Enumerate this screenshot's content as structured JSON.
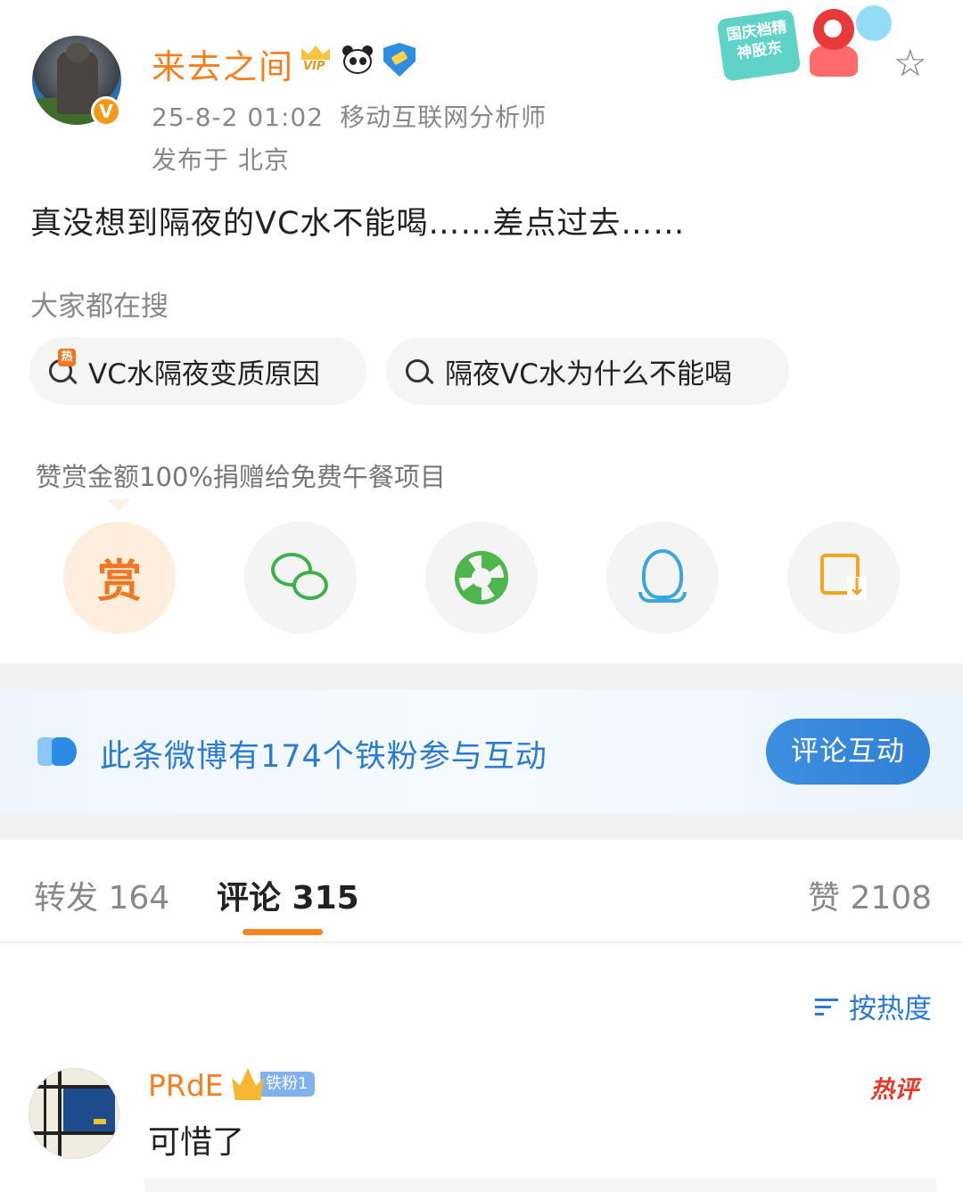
{
  "post": {
    "author": "来去之间",
    "verified_badge": "V",
    "vip_badge_text": "VIP",
    "date": "25-8-2 01:02",
    "author_title": "移动互联网分析师",
    "location": "发布于 北京",
    "content": "真没想到隔夜的VC水不能喝……差点过去……",
    "promo_text": "国庆档精神股东"
  },
  "search": {
    "title": "大家都在搜",
    "hot_tag": "热",
    "chips": [
      "VC水隔夜变质原因",
      "隔夜VC水为什么不能喝"
    ]
  },
  "reward": {
    "note": "赞赏金额100%捐赠给免费午餐项目",
    "button_label": "赏"
  },
  "share": {
    "icons": [
      "reward-icon",
      "wechat-icon",
      "moments-icon",
      "qq-icon",
      "save-image-icon"
    ]
  },
  "fans": {
    "text": "此条微博有174个铁粉参与互动",
    "button": "评论互动"
  },
  "tabs": {
    "repost": "转发 164",
    "comments": "评论 315",
    "likes": "赞 2108"
  },
  "sort": {
    "label": "按热度"
  },
  "comment": {
    "user": "PRdE",
    "fan_badge": "铁粉1",
    "hot_tag": "热评",
    "text": "可惜了"
  },
  "colors": {
    "accent_orange": "#f57f1f",
    "link_blue": "#2a7bd6",
    "button_blue": "#2f7fd7"
  }
}
